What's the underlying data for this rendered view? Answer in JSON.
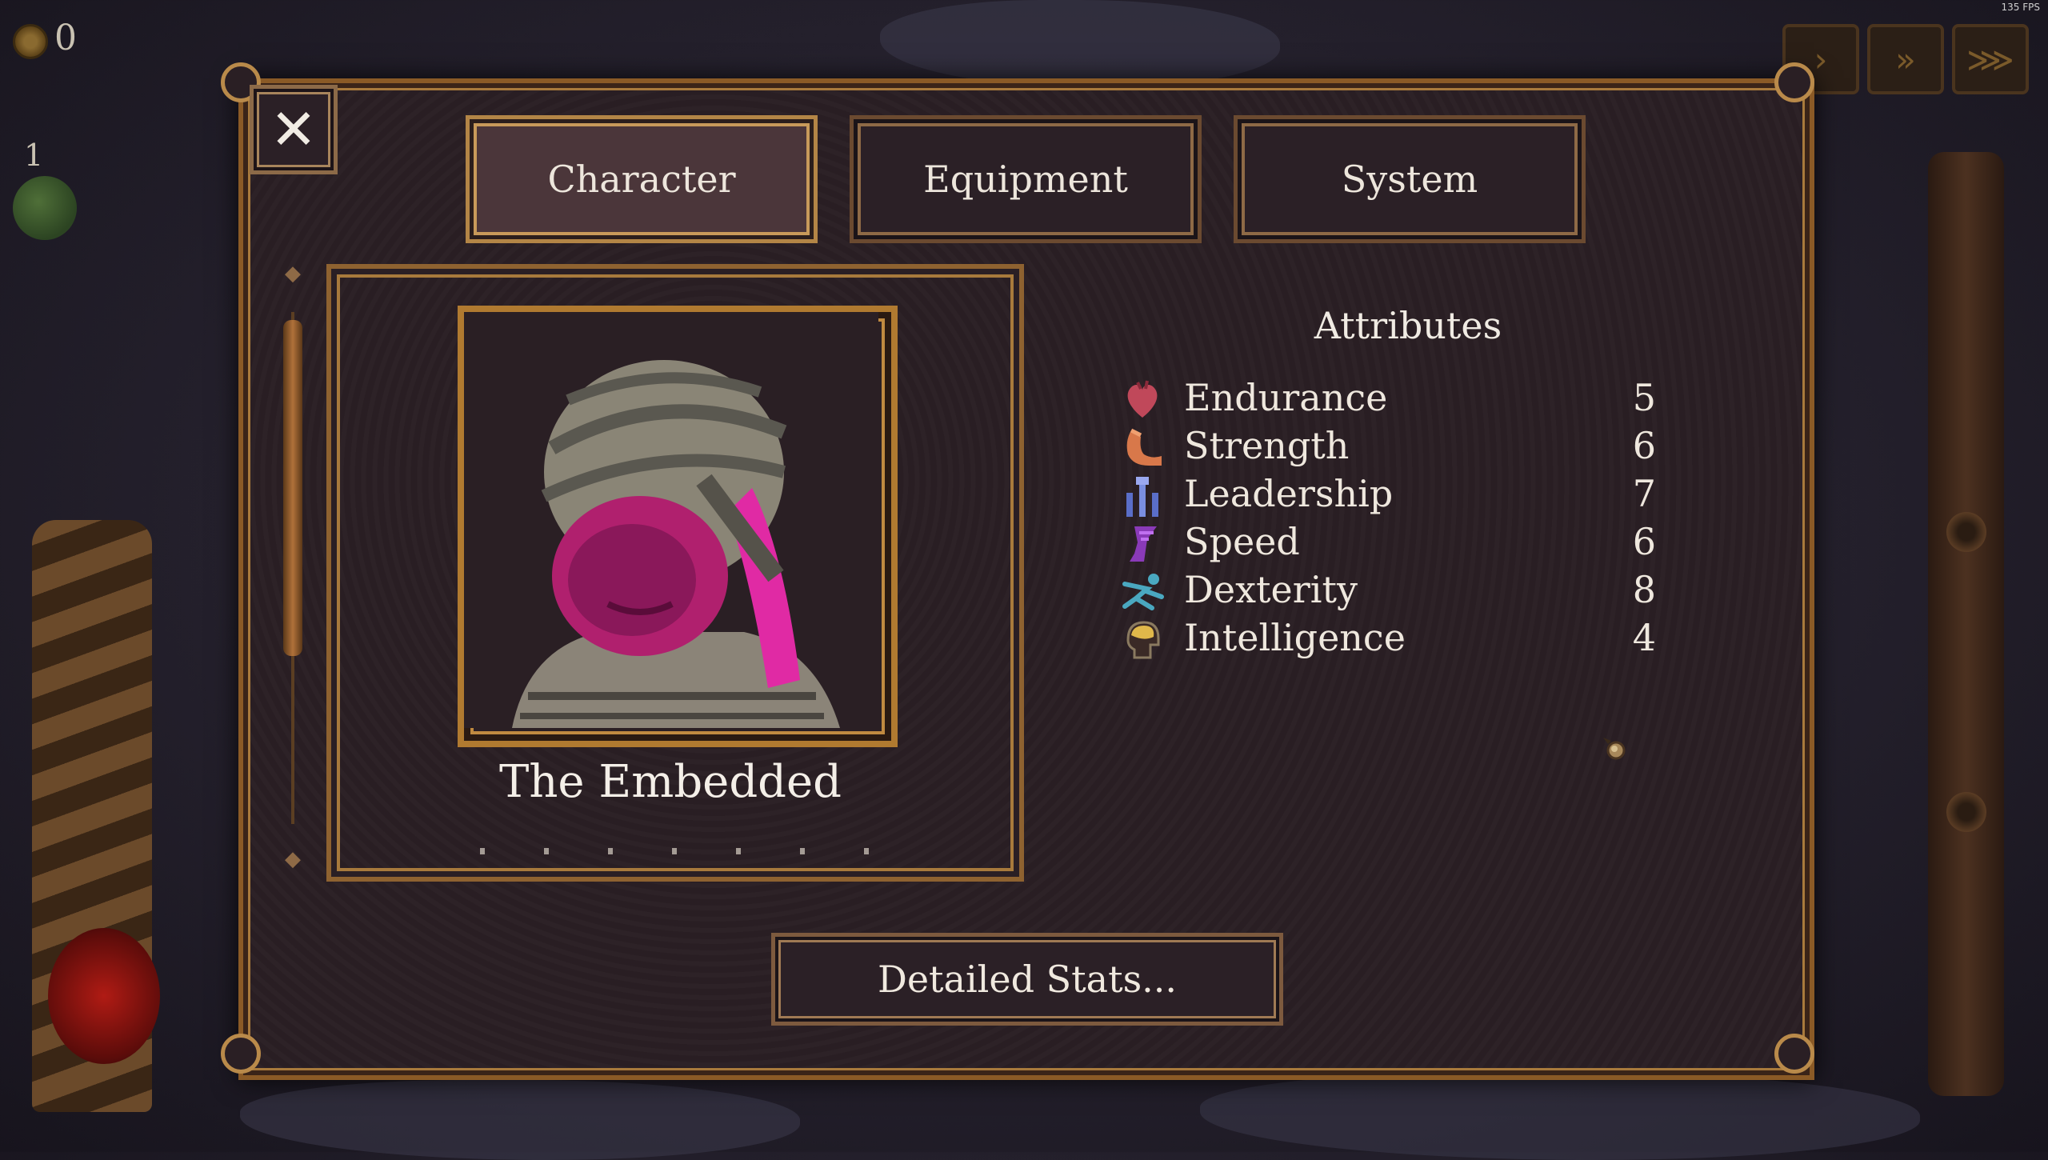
{
  "hud": {
    "gold_count": "0",
    "party_level": "1",
    "fps": "135 FPS",
    "speed_controls": [
      {
        "icon": "play-speed-1-icon",
        "symbol": "›"
      },
      {
        "icon": "play-speed-2-icon",
        "symbol": "»"
      },
      {
        "icon": "play-speed-3-icon",
        "symbol": "⋙"
      }
    ]
  },
  "dialog": {
    "close_symbol": "✕",
    "tabs": [
      {
        "label": "Character",
        "active": true
      },
      {
        "label": "Equipment",
        "active": false
      },
      {
        "label": "System",
        "active": false
      }
    ]
  },
  "character": {
    "name": "The Embedded"
  },
  "attributes": {
    "title": "Attributes",
    "items": [
      {
        "label": "Endurance",
        "value": "5",
        "icon": "heart-icon",
        "color": "#c0485a"
      },
      {
        "label": "Strength",
        "value": "6",
        "icon": "flexed-arm-icon",
        "color": "#d8784a"
      },
      {
        "label": "Leadership",
        "value": "7",
        "icon": "banners-icon",
        "color": "#5a6ec8"
      },
      {
        "label": "Speed",
        "value": "6",
        "icon": "winged-boot-icon",
        "color": "#8a3ab8"
      },
      {
        "label": "Dexterity",
        "value": "8",
        "icon": "leaping-figure-icon",
        "color": "#4aa8c0"
      },
      {
        "label": "Intelligence",
        "value": "4",
        "icon": "head-brain-icon",
        "color": "#e0b84a"
      }
    ]
  },
  "buttons": {
    "detailed_stats": "Detailed Stats..."
  },
  "colors": {
    "frame_gold": "#b07a30",
    "panel_bg": "#2a1f24",
    "text": "#efe8de"
  }
}
